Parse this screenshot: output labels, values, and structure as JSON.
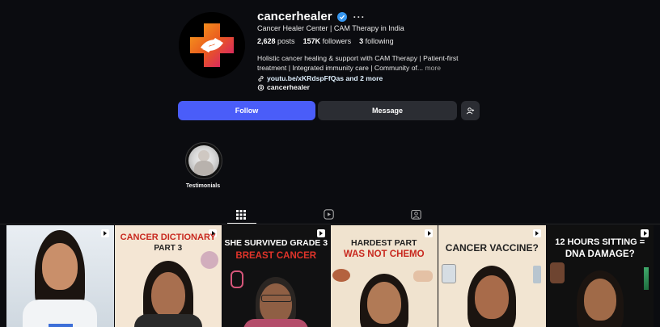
{
  "profile": {
    "username": "cancerhealer",
    "full_name": "Cancer Healer Center | CAM Therapy in India",
    "stats": {
      "posts_count": "2,628",
      "posts_label": "posts",
      "followers_count": "157K",
      "followers_label": "followers",
      "following_count": "3",
      "following_label": "following"
    },
    "bio": "Holistic cancer healing & support with CAM Therapy | Patient-first treatment | Integrated immunity care | Community of...",
    "bio_more": "more",
    "link": "youtu.be/xKRdspFfQas and 2 more",
    "threads_handle": "cancerhealer"
  },
  "actions": {
    "follow_label": "Follow",
    "message_label": "Message"
  },
  "highlights": [
    {
      "label": "Testimonials"
    }
  ],
  "tabs": [
    {
      "icon": "grid-icon",
      "active": true
    },
    {
      "icon": "reels-icon",
      "active": false
    },
    {
      "icon": "tagged-icon",
      "active": false
    }
  ],
  "posts": [
    {
      "title": ""
    },
    {
      "title_line1": "CANCER DICTIONARY",
      "title_line2": "PART 3"
    },
    {
      "title_line1": "SHE SURVIVED GRADE 3",
      "title_line2": "BREAST CANCER"
    },
    {
      "title_line1": "HARDEST PART",
      "title_line2": "WAS NOT CHEMO"
    },
    {
      "title_line1": "CANCER VACCINE?"
    },
    {
      "title_line1": "12 HOURS SITTING =",
      "title_line2": "DNA DAMAGE?"
    }
  ],
  "colors": {
    "background": "#0b0c10",
    "follow_button": "#4a5df9",
    "secondary_button": "#2b2d33",
    "verified": "#3797f0",
    "title_red": "#c8281e"
  }
}
